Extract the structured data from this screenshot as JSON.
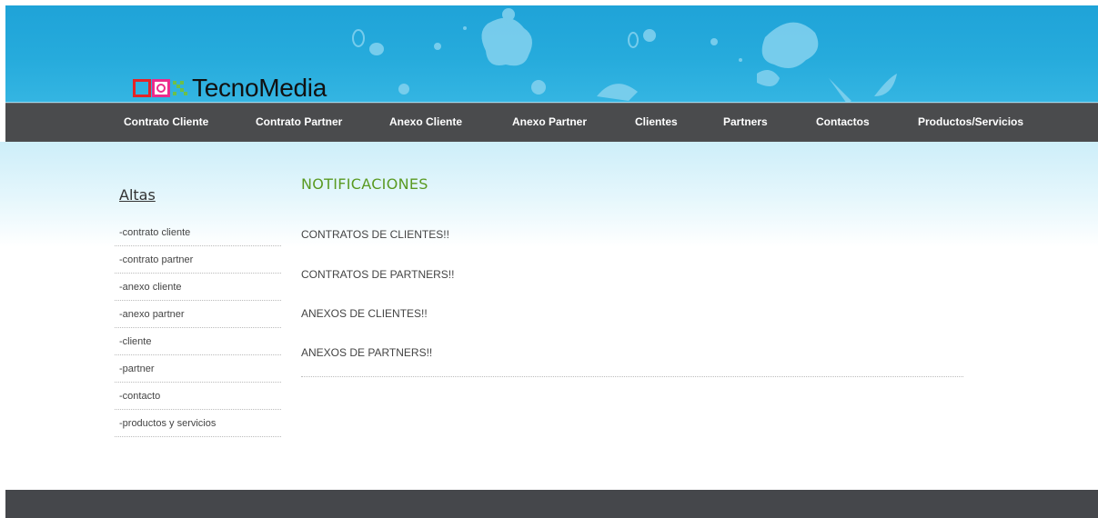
{
  "header": {
    "brand_name": "TecnoMedia",
    "logo_icon": "tecnomedia-logo-squares",
    "colors": {
      "banner": "#26abdc",
      "splash": "#7fd0ee",
      "logo_red": "#e52427",
      "logo_pink": "#ec2c8c",
      "logo_green": "#6cc04a"
    }
  },
  "nav": {
    "items": [
      {
        "label": "Contrato Cliente"
      },
      {
        "label": "Contrato Partner"
      },
      {
        "label": "Anexo Cliente"
      },
      {
        "label": "Anexo Partner"
      },
      {
        "label": "Clientes"
      },
      {
        "label": "Partners"
      },
      {
        "label": "Contactos"
      },
      {
        "label": "Productos/Servicios"
      }
    ]
  },
  "sidebar": {
    "title": "Altas",
    "items": [
      {
        "label": "-contrato cliente"
      },
      {
        "label": "-contrato partner"
      },
      {
        "label": "-anexo cliente"
      },
      {
        "label": "-anexo partner"
      },
      {
        "label": "-cliente"
      },
      {
        "label": "-partner"
      },
      {
        "label": "-contacto"
      },
      {
        "label": "-productos y servicios"
      }
    ]
  },
  "main": {
    "title": "NOTIFICACIONES",
    "notifications": [
      {
        "text": "CONTRATOS DE CLIENTES!!"
      },
      {
        "text": "CONTRATOS DE PARTNERS!!"
      },
      {
        "text": "ANEXOS DE CLIENTES!!"
      },
      {
        "text": "ANEXOS DE PARTNERS!!"
      }
    ]
  }
}
